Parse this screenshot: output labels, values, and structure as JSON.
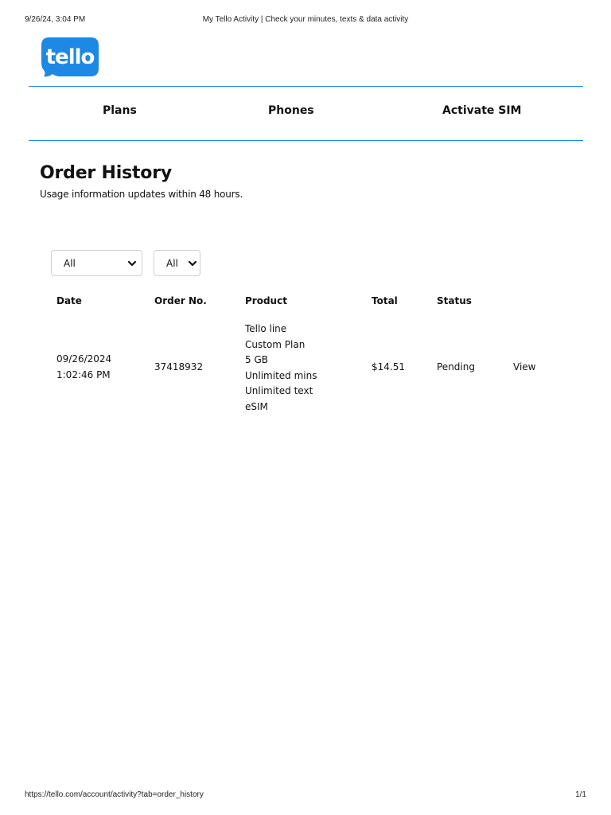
{
  "print_header": {
    "datetime": "9/26/24, 3:04 PM",
    "page_title": "My Tello Activity | Check your minutes, texts & data activity"
  },
  "logo": {
    "text": "tello",
    "color": "#1e88e5"
  },
  "nav": {
    "items": [
      {
        "label": "Plans"
      },
      {
        "label": "Phones"
      },
      {
        "label": "Activate SIM"
      }
    ]
  },
  "main": {
    "title": "Order History",
    "subtitle": "Usage information updates within 48 hours."
  },
  "filters": [
    {
      "value": "All",
      "icon": "chevron-down-icon"
    },
    {
      "value": "All",
      "icon": "chevron-down-icon"
    }
  ],
  "table": {
    "headers": [
      "Date",
      "Order No.",
      "Product",
      "Total",
      "Status"
    ],
    "rows": [
      {
        "date_line1": "09/26/2024",
        "date_line2": "1:02:46 PM",
        "order_no": "37418932",
        "product_lines": [
          "Tello line",
          "Custom Plan",
          "5 GB",
          "Unlimited mins",
          "Unlimited text",
          "eSIM"
        ],
        "total": "$14.51",
        "status": "Pending",
        "action": "View"
      }
    ]
  },
  "print_footer": {
    "url": "https://tello.com/account/activity?tab=order_history",
    "page": "1/1"
  }
}
